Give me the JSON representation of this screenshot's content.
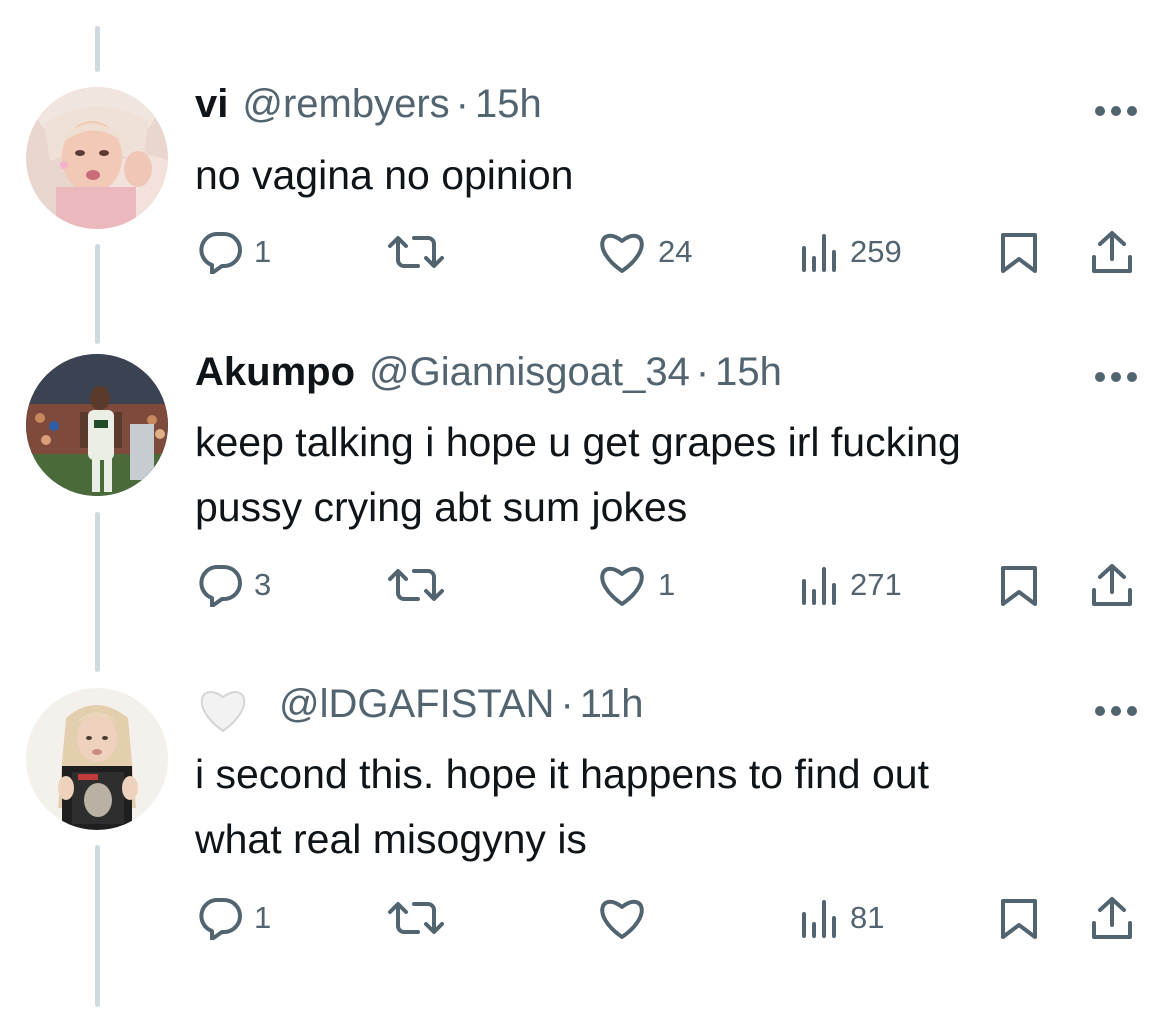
{
  "thread": {
    "tweets": [
      {
        "display_name": "vi",
        "handle": "@rembyers",
        "separator": "·",
        "time": "15h",
        "text_lines": [
          "no vagina no opinion"
        ],
        "replies": "1",
        "retweets": "",
        "likes": "24",
        "views": "259"
      },
      {
        "display_name": "Akumpo",
        "handle": "@Giannisgoat_34",
        "separator": "·",
        "time": "15h",
        "text_lines": [
          "keep talking i hope u get grapes irl fucking",
          "pussy crying abt sum jokes"
        ],
        "replies": "3",
        "retweets": "",
        "likes": "1",
        "views": "271"
      },
      {
        "display_name": "",
        "handle": "@lDGAFISTAN",
        "separator": "·",
        "time": "11h",
        "text_lines": [
          "i second this. hope it happens to find out",
          "what real misogyny is"
        ],
        "replies": "1",
        "retweets": "",
        "likes": "",
        "views": "81"
      }
    ]
  },
  "icons": {
    "reply": "reply-icon",
    "retweet": "retweet-icon",
    "like": "heart-icon",
    "views": "views-icon",
    "bookmark": "bookmark-icon",
    "share": "share-icon",
    "more": "more-icon",
    "name_emoji": "white-heart-icon"
  },
  "colors": {
    "text": "#0f1419",
    "secondary": "#536471",
    "thread_line": "#cfd9de",
    "background": "#ffffff"
  }
}
